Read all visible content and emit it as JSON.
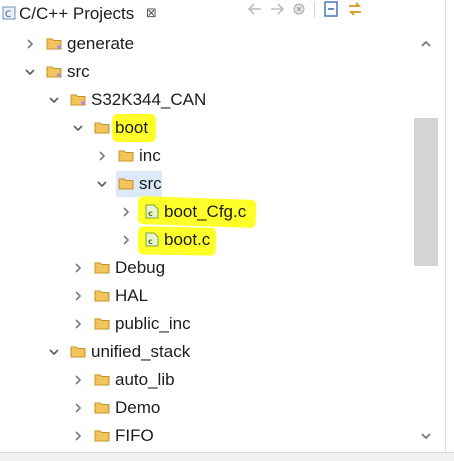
{
  "view": {
    "title": "C/C++ Projects",
    "close_glyph": "⊠",
    "icon": "cpp-projects-view-icon"
  },
  "toolbar": {
    "items": [
      "back-arrow-icon",
      "forward-arrow-icon",
      "link-chain-icon",
      "collapse-all-icon",
      "sync-icon"
    ]
  },
  "tree": {
    "generate": "generate",
    "src": "src",
    "s32k344_can": "S32K344_CAN",
    "boot": "boot",
    "inc": "inc",
    "boot_src": "src",
    "boot_cfg_c": "boot_Cfg.c",
    "boot_c": "boot.c",
    "debug": "Debug",
    "hal": "HAL",
    "public_inc": "public_inc",
    "unified_stack": "unified_stack",
    "auto_lib": "auto_lib",
    "demo": "Demo",
    "fifo": "FIFO"
  },
  "colors": {
    "highlight": "#ffff29",
    "selection": "#dbe9f8",
    "folder": "#e8b84f",
    "c_file": "#8cae3b"
  }
}
